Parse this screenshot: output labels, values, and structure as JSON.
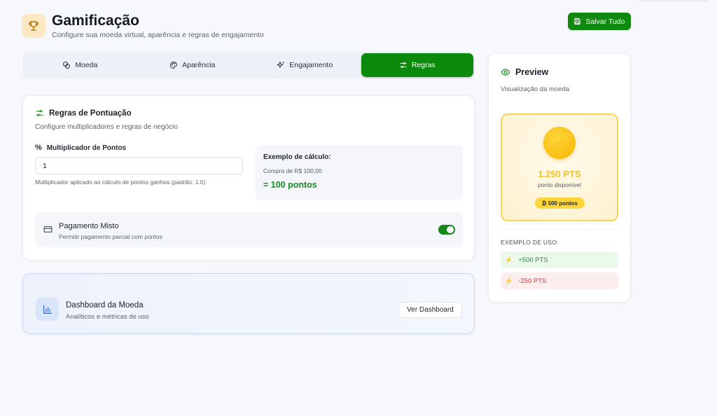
{
  "header": {
    "title": "Gamificação",
    "subtitle": "Configure sua moeda virtual, aparência e regras de engajamento",
    "save_label": "Salvar Tudo"
  },
  "tabs": [
    {
      "label": "Moeda",
      "icon": "coins-icon",
      "active": false
    },
    {
      "label": "Aparência",
      "icon": "palette-icon",
      "active": false
    },
    {
      "label": "Engajamento",
      "icon": "sparkles-icon",
      "active": false
    },
    {
      "label": "Regras",
      "icon": "sliders-icon",
      "active": true
    }
  ],
  "rules": {
    "title": "Regras de Pontuação",
    "description": "Configure multiplicadores e regras de negócio",
    "multiplier_label": "Multiplicador de Pontos",
    "multiplier_value": "1",
    "multiplier_help": "Multiplicador aplicado ao cálculo de pontos ganhos (padrão: 1.0)",
    "example_title": "Exemplo de cálculo:",
    "example_line": "Compra de R$ 100,00",
    "example_result": "= 100 pontos",
    "mixed_title": "Pagamento Misto",
    "mixed_desc": "Permitir pagamento parcial com pontos",
    "mixed_enabled": true
  },
  "dashboard": {
    "title": "Dashboard da Moeda",
    "description": "Analíticos e métricas de uso",
    "button_label": "Ver Dashboard"
  },
  "preview": {
    "title": "Preview",
    "description": "Visualização da moeda",
    "coin_value": "1.250 PTS",
    "coin_label": "ponto disponível",
    "coin_badge": "₿ 500 pontos",
    "usage_heading": "EXEMPLO DE USO:",
    "usage_plus": "+500 PTS",
    "usage_minus": "-250 PTS"
  },
  "colors": {
    "accent": "#0c8a0c",
    "coin": "#f7b400",
    "positive": "#2f8a3b",
    "negative": "#c4383a"
  }
}
